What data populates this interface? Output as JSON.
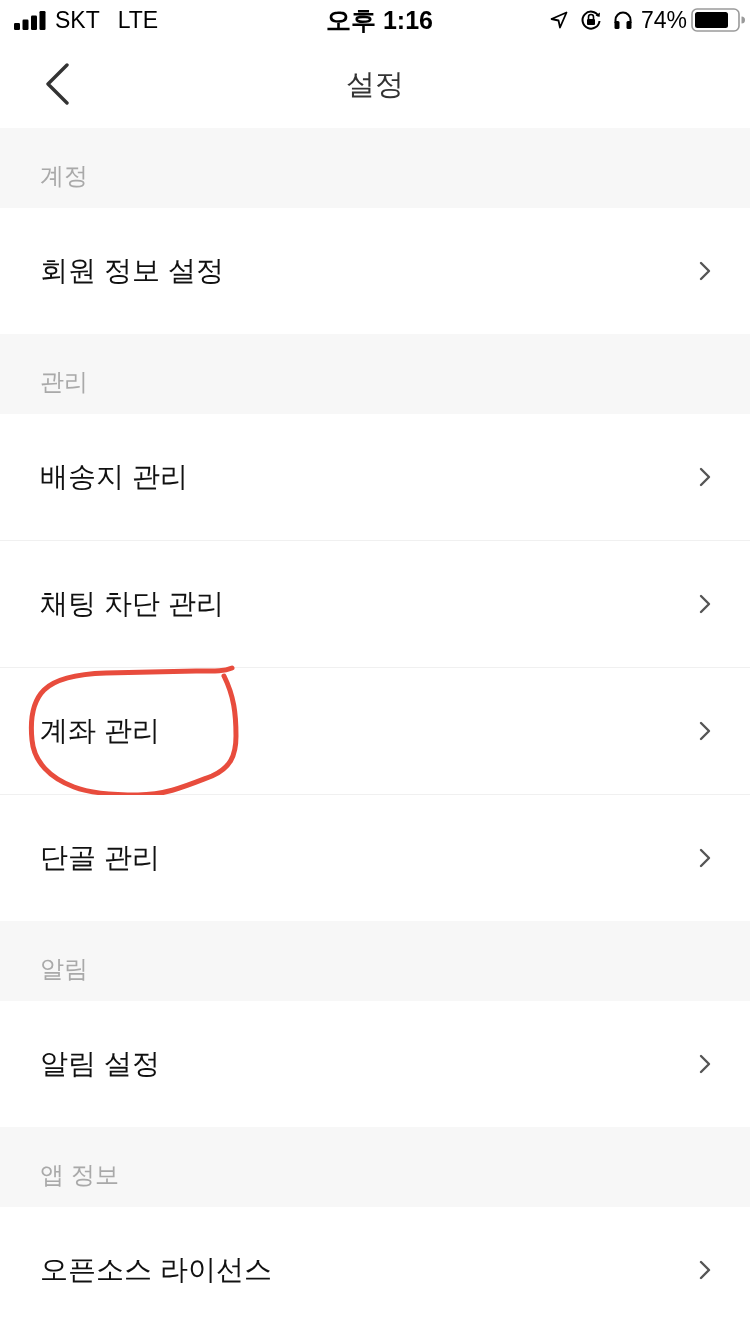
{
  "status_bar": {
    "carrier": "SKT",
    "network": "LTE",
    "time": "오후 1:16",
    "battery": "74%"
  },
  "nav_bar": {
    "title": "설정"
  },
  "sections": [
    {
      "title": "계정",
      "items": [
        {
          "label": "회원 정보 설정",
          "circled": false
        }
      ]
    },
    {
      "title": "관리",
      "items": [
        {
          "label": "배송지 관리",
          "circled": false
        },
        {
          "label": "채팅 차단 관리",
          "circled": false
        },
        {
          "label": "계좌 관리",
          "circled": true
        },
        {
          "label": "단골 관리",
          "circled": false
        }
      ]
    },
    {
      "title": "알림",
      "items": [
        {
          "label": "알림 설정",
          "circled": false
        }
      ]
    },
    {
      "title": "앱 정보",
      "items": [
        {
          "label": "오픈소스 라이선스",
          "circled": false
        }
      ]
    }
  ]
}
